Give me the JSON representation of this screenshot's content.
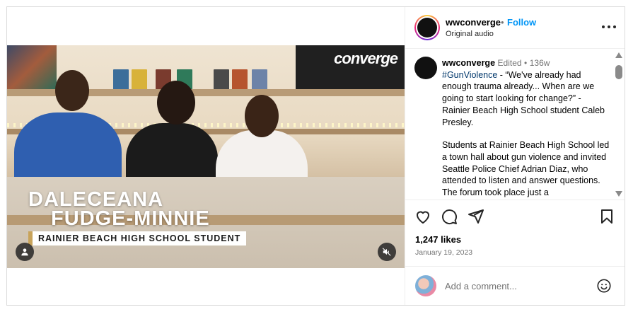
{
  "video": {
    "brand_overlay": "converge",
    "name_line1": "DALECEANA",
    "name_line2": "FUDGE-MINNIE",
    "subtitle": "RAINIER BEACH HIGH SCHOOL STUDENT"
  },
  "header": {
    "username": "wwconverge",
    "separator": "•",
    "follow_label": "Follow",
    "audio_label": "Original audio"
  },
  "caption": {
    "username": "wwconverge",
    "edited_label": "Edited",
    "dot": "•",
    "age": "136w",
    "hashtag": "#GunViolence",
    "body_p1": " - “We've already had enough trauma already... When are we going to start looking for change?” - Rainier Beach High School student Caleb Presley.",
    "body_p2": "Students at Rainier Beach High School led a town hall about gun violence and invited Seattle Police Chief Adrian Diaz, who attended to listen and answer questions. The forum took place just a"
  },
  "actions": {
    "likes": "1,247 likes",
    "date": "January 19, 2023"
  },
  "comment": {
    "placeholder": "Add a comment..."
  },
  "icons": {
    "like": "heart-icon",
    "comment": "comment-icon",
    "share": "share-icon",
    "save": "bookmark-icon",
    "emoji": "emoji-icon",
    "more": "more-icon",
    "user_tag": "user-icon",
    "mute": "muted-speaker-icon"
  },
  "colors": {
    "follow": "#0095f6",
    "hashtag": "#00376b",
    "meta": "#737373"
  }
}
